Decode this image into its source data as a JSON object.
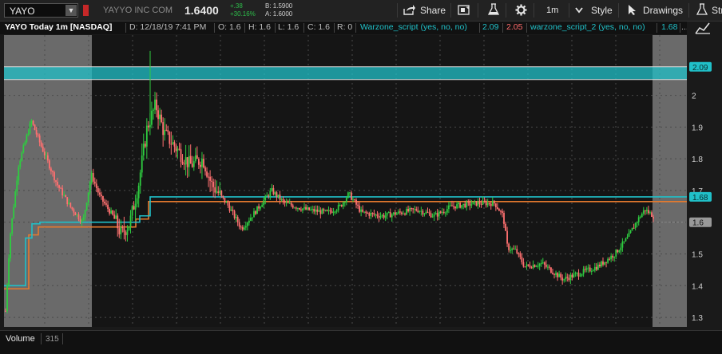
{
  "toolbar": {
    "symbol": "YAYO",
    "company": "YAYYO INC COM",
    "last_price": "1.6400",
    "net_change": "+.38",
    "pct_change": "+30.16%",
    "bid": "B: 1.5900",
    "ask": "A: 1.6000",
    "share_label": "Share",
    "timeframe_label": "1m",
    "style_label": "Style",
    "drawings_label": "Drawings",
    "truncated_label": "Str",
    "icons": [
      "share-icon",
      "screenshot-icon",
      "flask-icon",
      "gear-icon",
      "chevron-down-icon",
      "cursor-icon",
      "flask-icon"
    ]
  },
  "infobar": {
    "title": "YAYO Today 1m [NASDAQ]",
    "date": "D: 12/18/19 7:41 PM",
    "open": "O: 1.6",
    "high": "H: 1.6",
    "low": "L: 1.6",
    "close": "C: 1.6",
    "range": "R: 0",
    "study1_name": "Warzone_script (yes, no, no)",
    "study1_val_a": "2.09",
    "study1_val_b": "2.05",
    "study2_name": "warzone_script_2 (yes, no, no)",
    "study2_val": "1.68",
    "more": "..."
  },
  "chart_data": {
    "type": "candlestick",
    "y_ticks": [
      "2",
      "1.9",
      "1.8",
      "1.7",
      "1.6",
      "1.5",
      "1.4",
      "1.3"
    ],
    "ylim": [
      1.27,
      2.19
    ],
    "grid": true,
    "price_labels": [
      {
        "value": 2.09,
        "text": "2.09",
        "color": "#20c0c8"
      },
      {
        "value": 1.68,
        "text": "1.68",
        "color": "#20c0c8"
      },
      {
        "value": 1.6,
        "text": "1.6",
        "color": "#999999"
      }
    ],
    "zone_band": [
      2.05,
      2.09
    ],
    "level_cyan": 1.68,
    "level_orange": 1.665,
    "colors": {
      "up": "#2ecc40",
      "down": "#ff7070",
      "cyan": "#20c0c8",
      "orange": "#e67a2e"
    },
    "path": [
      [
        0,
        1.32
      ],
      [
        1,
        1.55
      ],
      [
        3,
        1.78
      ],
      [
        6,
        1.92
      ],
      [
        8,
        1.85
      ],
      [
        12,
        1.72
      ],
      [
        15,
        1.65
      ],
      [
        18,
        1.6
      ],
      [
        20,
        1.75
      ],
      [
        22,
        1.68
      ],
      [
        25,
        1.62
      ],
      [
        27,
        1.56
      ],
      [
        29,
        1.6
      ],
      [
        31,
        1.72
      ],
      [
        33,
        1.9
      ],
      [
        35,
        1.97
      ],
      [
        37,
        1.88
      ],
      [
        40,
        1.83
      ],
      [
        43,
        1.78
      ],
      [
        46,
        1.8
      ],
      [
        48,
        1.72
      ],
      [
        52,
        1.65
      ],
      [
        55,
        1.58
      ],
      [
        58,
        1.63
      ],
      [
        62,
        1.7
      ],
      [
        65,
        1.66
      ],
      [
        70,
        1.64
      ],
      [
        75,
        1.63
      ],
      [
        78,
        1.65
      ],
      [
        80,
        1.69
      ],
      [
        83,
        1.63
      ],
      [
        88,
        1.62
      ],
      [
        92,
        1.63
      ],
      [
        96,
        1.64
      ],
      [
        100,
        1.62
      ],
      [
        104,
        1.65
      ],
      [
        110,
        1.66
      ],
      [
        114,
        1.66
      ],
      [
        116,
        1.62
      ],
      [
        117,
        1.52
      ],
      [
        119,
        1.51
      ],
      [
        121,
        1.46
      ],
      [
        125,
        1.47
      ],
      [
        130,
        1.42
      ],
      [
        134,
        1.44
      ],
      [
        138,
        1.46
      ],
      [
        142,
        1.5
      ],
      [
        145,
        1.55
      ],
      [
        147,
        1.6
      ],
      [
        149,
        1.64
      ],
      [
        151,
        1.62
      ]
    ]
  },
  "volume": {
    "label": "Volume",
    "value": "315"
  }
}
